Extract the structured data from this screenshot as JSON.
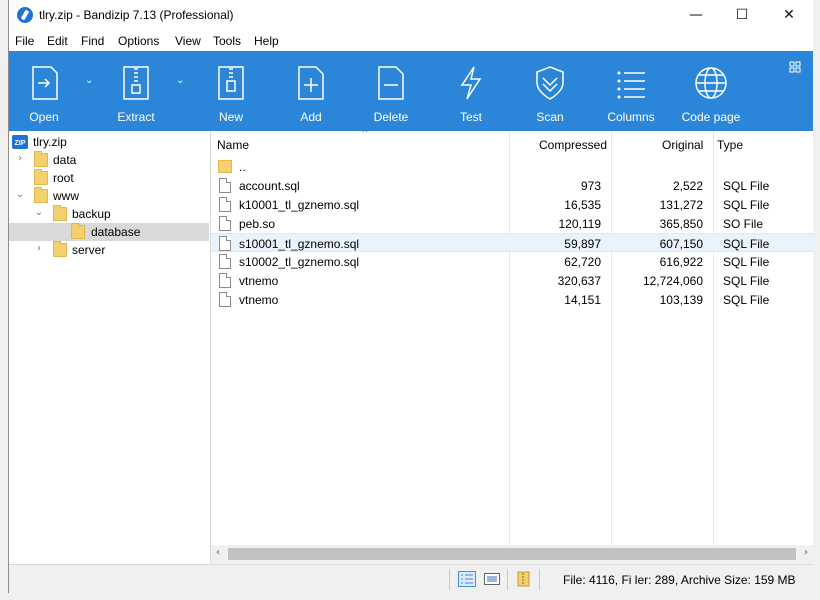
{
  "window": {
    "title": "tlry.zip - Bandizip 7.13 (Professional)",
    "controls": {
      "minimize": "—",
      "maximize": "☐",
      "close": "✕"
    }
  },
  "menu": [
    "File",
    "Edit",
    "Find",
    "Options",
    "View",
    "Tools",
    "Help"
  ],
  "toolbar": {
    "buttons": [
      {
        "label": "Open",
        "icon": "open-icon"
      },
      {
        "label": "Extract",
        "icon": "extract-icon"
      },
      {
        "label": "New",
        "icon": "new-archive-icon"
      },
      {
        "label": "Add",
        "icon": "add-file-icon"
      },
      {
        "label": "Delete",
        "icon": "delete-file-icon"
      },
      {
        "label": "Test",
        "icon": "test-lightning-icon"
      },
      {
        "label": "Scan",
        "icon": "scan-shield-icon"
      },
      {
        "label": "Columns",
        "icon": "columns-list-icon"
      },
      {
        "label": "Code page",
        "icon": "globe-icon"
      }
    ],
    "dropdown_arrow": "⌄"
  },
  "tree": {
    "root": "tlry.zip",
    "items": [
      {
        "label": "data",
        "toggle": "›"
      },
      {
        "label": "root",
        "toggle": ""
      },
      {
        "label": "www",
        "toggle": "⌄"
      },
      {
        "label": "backup",
        "toggle": "⌄"
      },
      {
        "label": "database",
        "toggle": ""
      },
      {
        "label": "server",
        "toggle": "›"
      }
    ],
    "selected": "database"
  },
  "columns": {
    "name": "Name",
    "compressed": "Compressed",
    "original": "Original",
    "type": "Type",
    "sort_indicator": "^"
  },
  "files": [
    {
      "name": "..",
      "compressed": "",
      "original": "",
      "type": "",
      "kind": "folder"
    },
    {
      "name": "account.sql",
      "compressed": "973",
      "original": "2,522",
      "type": "SQL File",
      "kind": "file"
    },
    {
      "name": "k10001_tl_gznemo.sql",
      "compressed": "16,535",
      "original": "131,272",
      "type": "SQL File",
      "kind": "file"
    },
    {
      "name": "peb.so",
      "compressed": "120,119",
      "original": "365,850",
      "type": "SO File",
      "kind": "file"
    },
    {
      "name": "s10001_tl_gznemo.sql",
      "compressed": "59,897",
      "original": "607,150",
      "type": "SQL File",
      "kind": "file"
    },
    {
      "name": "s10002_tl_gznemo.sql",
      "compressed": "62,720",
      "original": "616,922",
      "type": "SQL File",
      "kind": "file"
    },
    {
      "name": "vtnemo",
      "compressed": "320,637",
      "original": "12,724,060",
      "type": "SQL File",
      "kind": "file"
    },
    {
      "name": "vtnemo",
      "compressed": "14,151",
      "original": "103,139",
      "type": "SQL File",
      "kind": "file"
    }
  ],
  "hovered_row": "s10001_tl_gznemo.sql",
  "scroll": {
    "left": "‹",
    "right": "›"
  },
  "status": {
    "text": "File: 4116, Fi ler: 289, Archive Size: 159 MB"
  },
  "colors": {
    "toolbar": "#2b86d9",
    "folder": "#f4d06f",
    "accent": "#1e73d6",
    "hover": "#eaf3fc",
    "selection": "#d9d9d9"
  }
}
